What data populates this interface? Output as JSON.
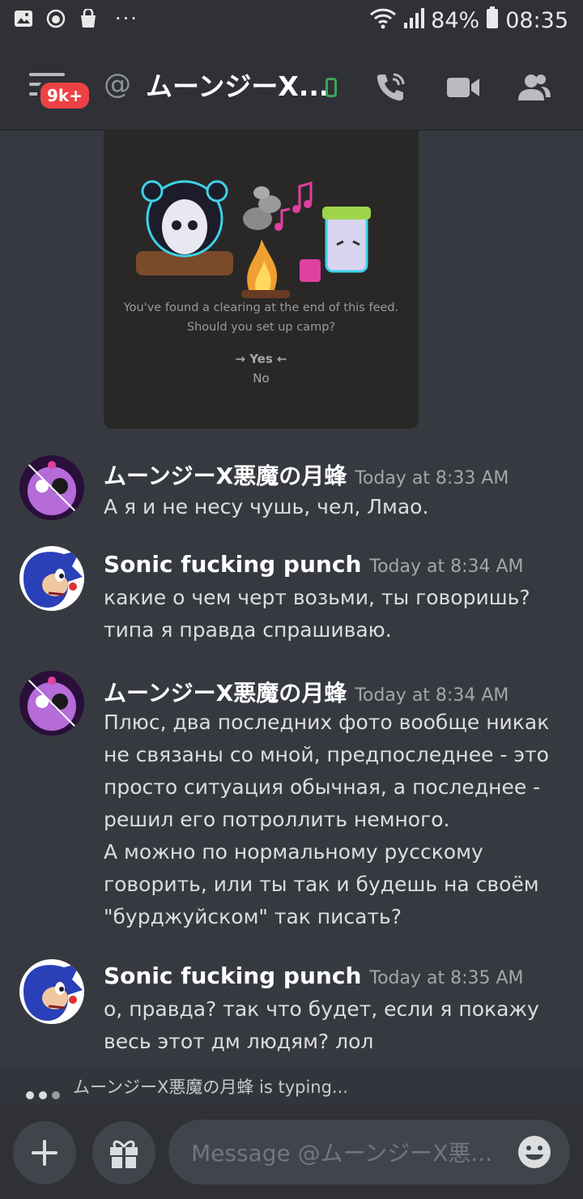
{
  "status_bar": {
    "battery": "84%",
    "time": "08:35",
    "more": "···"
  },
  "header": {
    "unread_badge": "9k+",
    "at_symbol": "@",
    "channel_name": "ムーンジーX..."
  },
  "embed": {
    "line1": "You've found a clearing at the end of this feed.",
    "line2": "Should you set up camp?",
    "yes": "→ Yes ←",
    "no": "No"
  },
  "messages": [
    {
      "author": "ムーンジーX悪魔の月蜂",
      "time": "Today at 8:33 AM",
      "lines": [
        "А я и не несу чушь, чел, Лмао."
      ]
    },
    {
      "author": "Sonic fucking punch",
      "time": "Today at 8:34 AM",
      "lines": [
        "какие о чем черт возьми, ты говоришь?",
        "типа я правда спрашиваю."
      ]
    },
    {
      "author": "ムーンジーX悪魔の月蜂",
      "time": "Today at 8:34 AM",
      "lines": [
        "Плюс, два последних фото вообще никак",
        "не связаны со мной, предпоследнее - это",
        "просто ситуация обычная, а последнее -",
        "решил его потроллить немного.",
        "А можно по нормальному русскому",
        "говорить, или ты так и будешь на своём",
        "\"бурджуйском\" так писать?"
      ]
    },
    {
      "author": "Sonic fucking punch",
      "time": "Today at 8:35 AM",
      "lines": [
        "о, правда? так что будет, если я покажу",
        "весь этот дм людям? лол"
      ]
    }
  ],
  "typing": {
    "text": "ムーンジーX悪魔の月蜂 is typing..."
  },
  "composer": {
    "placeholder": "Message @ムーンジーX悪..."
  },
  "colors": {
    "background": "#36393f",
    "header": "#2f3136",
    "badge": "#ed4245",
    "online": "#3ba55d"
  },
  "icons": [
    "gallery-icon",
    "app-icon",
    "shopping-bag-icon",
    "wifi-icon",
    "signal-icon",
    "battery-icon",
    "menu-icon",
    "phone-status-icon",
    "call-icon",
    "video-icon",
    "members-icon",
    "plus-icon",
    "gift-icon",
    "emoji-icon"
  ]
}
